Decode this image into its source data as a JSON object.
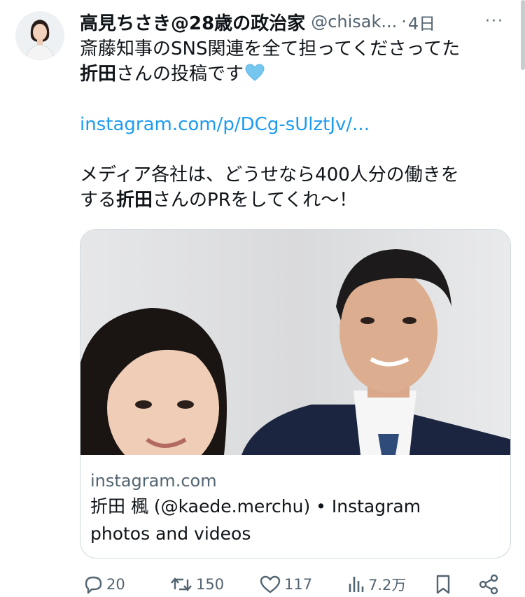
{
  "tweet": {
    "author_name": "高見ちさき@28歳の政治家",
    "author_handle": "@chisak...",
    "separator": "·",
    "time": "4日",
    "more_label": "···",
    "text": {
      "line1": "斎藤知事のSNS関連を全て担ってくださってた",
      "line2_bold": "折田",
      "line2_rest": "さんの投稿です",
      "link": "instagram.com/p/DCg-sUlztJv/...",
      "line3": "メディア各社は、どうせなら400人分の働きを",
      "line4_pre": "する",
      "line4_bold": "折田",
      "line4_rest": "さんのPRをしてくれ〜！"
    },
    "emoji": "light-blue-heart-icon"
  },
  "card": {
    "domain": "instagram.com",
    "title_line1": "折田 楓 (@kaede.merchu) • Instagram",
    "title_line2": "photos and videos"
  },
  "actions": {
    "replies": "20",
    "retweets": "150",
    "likes": "117",
    "views": "7.2万"
  },
  "colors": {
    "link": "#1d9bf0",
    "secondary_text": "#536471",
    "border": "#cfd9de",
    "suit": "#1b2540"
  }
}
